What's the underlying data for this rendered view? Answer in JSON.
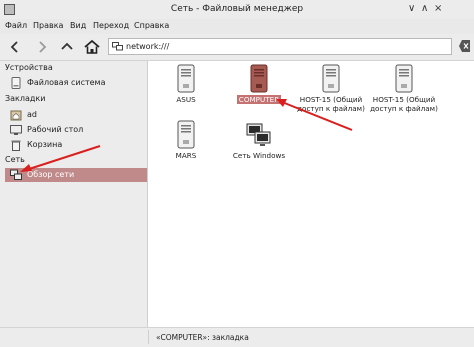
{
  "window": {
    "title": "Сеть - Файловый менеджер",
    "controls": [
      "∨",
      "∧",
      "×"
    ]
  },
  "menu": [
    "Файл",
    "Правка",
    "Вид",
    "Переход",
    "Справка"
  ],
  "toolbar": {
    "address": "network:///",
    "buttons": [
      "back",
      "forward",
      "up",
      "home"
    ]
  },
  "sidebar": {
    "devices_heading": "Устройства",
    "devices": [
      {
        "label": "Файловая система",
        "icon": "drive-icon"
      }
    ],
    "bookmarks_heading": "Закладки",
    "bookmarks": [
      {
        "label": "ad",
        "icon": "home-folder-icon"
      },
      {
        "label": "Рабочий стол",
        "icon": "desktop-icon"
      },
      {
        "label": "Корзина",
        "icon": "trash-icon"
      }
    ],
    "network_heading": "Сеть",
    "network": [
      {
        "label": "Обзор сети",
        "icon": "network-icon",
        "active": true
      }
    ]
  },
  "items": [
    {
      "label": "ASUS",
      "icon": "server-icon",
      "selected": false
    },
    {
      "label": "COMPUTER",
      "icon": "server-icon",
      "selected": true
    },
    {
      "label": "HOST-15 (Общий доступ к файлам)",
      "icon": "server-icon",
      "selected": false
    },
    {
      "label": "HOST-15 (Общий доступ к файлам)",
      "icon": "server-icon",
      "selected": false
    },
    {
      "label": "MARS",
      "icon": "server-icon",
      "selected": false
    },
    {
      "label": "Сеть Windows",
      "icon": "windows-network-icon",
      "selected": false
    }
  ],
  "status": "«COMPUTER»: закладка",
  "colors": {
    "selection": "#c47272",
    "arrow": "#d9201f",
    "sidebar_active": "#c08a8a"
  }
}
